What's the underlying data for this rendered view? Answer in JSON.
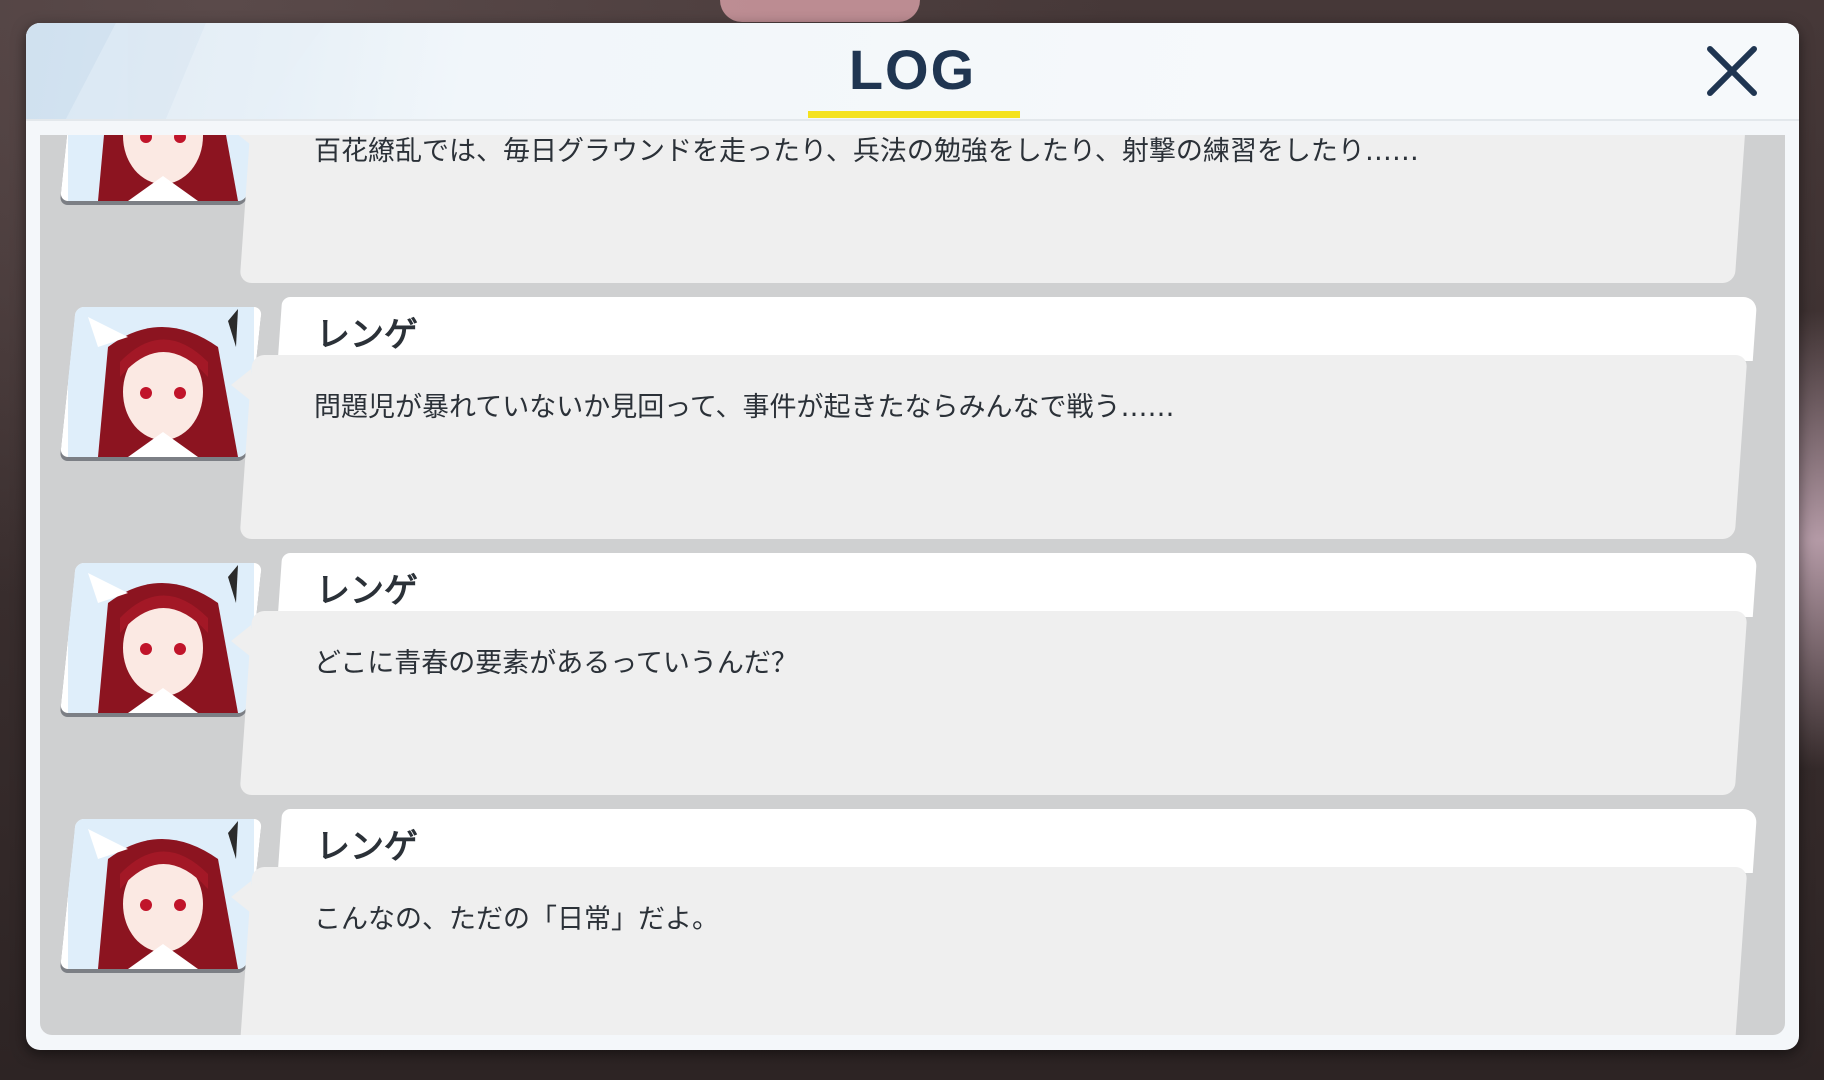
{
  "header": {
    "title": "LOG",
    "close_icon": "close-x-icon"
  },
  "colors": {
    "title": "#1f3551",
    "accent_underline": "#f4e21e"
  },
  "entries": [
    {
      "speaker": "",
      "message": "百花繚乱では、毎日グラウンドを走ったり、兵法の勉強をしたり、射撃の練習をしたり……"
    },
    {
      "speaker": "レンゲ",
      "message": "問題児が暴れていないか見回って、事件が起きたならみんなで戦う……"
    },
    {
      "speaker": "レンゲ",
      "message": "どこに青春の要素があるっていうんだ？"
    },
    {
      "speaker": "レンゲ",
      "message": "こんなの、ただの「日常」だよ。"
    }
  ]
}
